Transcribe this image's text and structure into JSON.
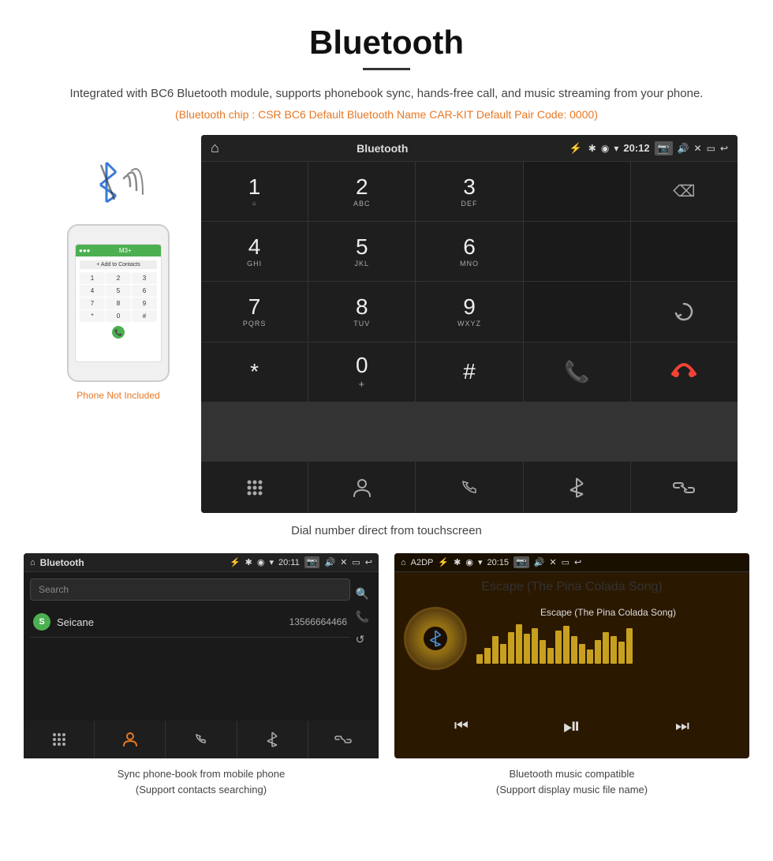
{
  "page": {
    "title": "Bluetooth",
    "description": "Integrated with BC6 Bluetooth module, supports phonebook sync, hands-free call, and music streaming from your phone.",
    "specs": "(Bluetooth chip : CSR BC6    Default Bluetooth Name CAR-KIT    Default Pair Code: 0000)",
    "phone_not_included": "Phone Not Included",
    "caption_main": "Dial number direct from touchscreen",
    "caption_left": "Sync phone-book from mobile phone\n(Support contacts searching)",
    "caption_right": "Bluetooth music compatible\n(Support display music file name)"
  },
  "large_screen": {
    "status_bar": {
      "home_icon": "⌂",
      "title": "Bluetooth",
      "usb_icon": "⚡",
      "bt_icon": "✱",
      "gps_icon": "◉",
      "signal_icon": "▾",
      "time": "20:12",
      "camera_icon": "📷",
      "volume_icon": "🔊",
      "close_icon": "✕",
      "window_icon": "▭",
      "back_icon": "↩"
    },
    "dialpad": [
      {
        "main": "1",
        "sub": ""
      },
      {
        "main": "2",
        "sub": "ABC"
      },
      {
        "main": "3",
        "sub": "DEF"
      },
      {
        "main": "",
        "sub": ""
      },
      {
        "main": "⌫",
        "sub": ""
      },
      {
        "main": "4",
        "sub": "GHI"
      },
      {
        "main": "5",
        "sub": "JKL"
      },
      {
        "main": "6",
        "sub": "MNO"
      },
      {
        "main": "",
        "sub": ""
      },
      {
        "main": "",
        "sub": ""
      },
      {
        "main": "7",
        "sub": "PQRS"
      },
      {
        "main": "8",
        "sub": "TUV"
      },
      {
        "main": "9",
        "sub": "WXYZ"
      },
      {
        "main": "",
        "sub": ""
      },
      {
        "main": "↺",
        "sub": ""
      },
      {
        "main": "*",
        "sub": ""
      },
      {
        "main": "0",
        "sub": "+"
      },
      {
        "main": "#",
        "sub": ""
      },
      {
        "main": "📞",
        "sub": "green"
      },
      {
        "main": "📞",
        "sub": "red"
      }
    ],
    "bottom_icons": [
      "⠿",
      "👤",
      "📞",
      "✱",
      "🔗"
    ]
  },
  "left_screen": {
    "status_bar": {
      "home_icon": "⌂",
      "title": "Bluetooth",
      "usb_icon": "⚡",
      "bt_icon": "✱",
      "gps_icon": "◉",
      "signal_icon": "▾",
      "time": "20:11",
      "camera_icon": "📷",
      "volume_icon": "🔊",
      "close_icon": "✕",
      "window_icon": "▭",
      "back_icon": "↩"
    },
    "search_placeholder": "Search",
    "contacts": [
      {
        "letter": "S",
        "name": "Seicane",
        "number": "13566664466"
      }
    ],
    "right_icons": [
      "🔍",
      "📞",
      "↺"
    ],
    "bottom_icons": [
      "⠿",
      "👤",
      "📞",
      "✱",
      "🔗"
    ]
  },
  "right_screen": {
    "status_bar": {
      "home_icon": "⌂",
      "title": "A2DP",
      "usb_icon": "⚡",
      "bt_icon": "✱",
      "gps_icon": "◉",
      "signal_icon": "▾",
      "time": "20:15",
      "camera_icon": "📷",
      "volume_icon": "🔊",
      "close_icon": "✕",
      "window_icon": "▭",
      "back_icon": "↩"
    },
    "song_title": "Escape (The Pina Colada Song)",
    "bt_music_icon": "✱",
    "viz_bars": [
      12,
      20,
      35,
      25,
      40,
      50,
      38,
      45,
      30,
      20,
      42,
      48,
      35,
      25,
      18,
      30,
      40,
      35,
      28,
      45
    ],
    "controls": {
      "prev_icon": "⏮",
      "play_icon": "⏯",
      "next_icon": "⏭"
    }
  },
  "phone": {
    "add_contacts": "+ Add to Contacts",
    "keypad": [
      "1",
      "2",
      "3",
      "4",
      "5",
      "6",
      "7",
      "8",
      "9",
      "*",
      "0",
      "#"
    ]
  }
}
